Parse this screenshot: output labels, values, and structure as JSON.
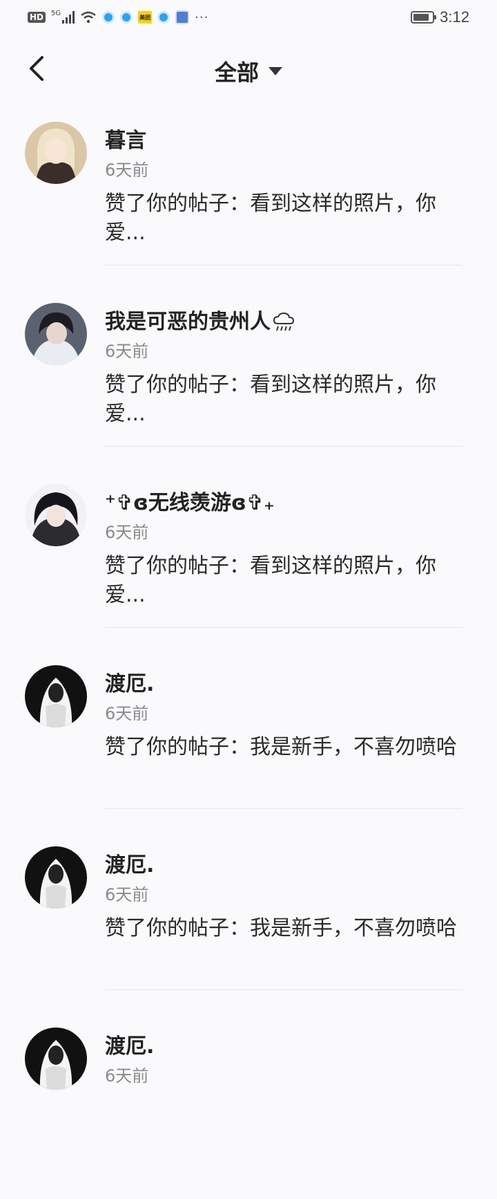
{
  "status_bar": {
    "hd": "HD",
    "network": "5G",
    "meituan": "美团",
    "time": "3:12",
    "battery_level": 0.85
  },
  "header": {
    "title": "全部",
    "back_icon": "chevron-left-icon",
    "dropdown_icon": "caret-down-icon"
  },
  "notifications": [
    {
      "name": "暮言",
      "time": "6天前",
      "text": "赞了你的帖子：看到这样的照片，你爱..."
    },
    {
      "name": "我是可恶的贵州人",
      "name_icon": "rain-cloud-icon",
      "time": "6天前",
      "text": "赞了你的帖子：看到这样的照片，你爱..."
    },
    {
      "name": "⁺✞ɞ无线羡游ɞ✞₊",
      "time": "6天前",
      "text": "赞了你的帖子：看到这样的照片，你爱..."
    },
    {
      "name": "渡厄.",
      "time": "6天前",
      "text": "赞了你的帖子：我是新手，不喜勿喷哈"
    },
    {
      "name": "渡厄.",
      "time": "6天前",
      "text": "赞了你的帖子：我是新手，不喜勿喷哈"
    },
    {
      "name": "渡厄.",
      "time": "6天前",
      "text": ""
    }
  ],
  "colors": {
    "background": "#fafafc",
    "text_primary": "#222222",
    "text_secondary": "#8a8a8a",
    "divider": "#e7e7ec"
  }
}
